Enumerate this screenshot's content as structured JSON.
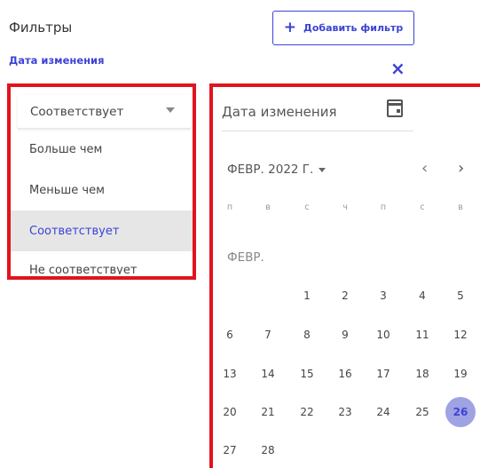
{
  "header": {
    "title": "Фильтры",
    "add_filter_label": "Добавить фильтр",
    "add_icon": "+",
    "active_filter_label": "Дата изменения",
    "close_icon": "×"
  },
  "condition_select": {
    "value": "Соответствует",
    "options": [
      "Больше чем",
      "Меньше чем",
      "Соответствует",
      "Не соответствует"
    ],
    "selected_option": "Соответствует"
  },
  "date_picker": {
    "field_label": "Дата изменения",
    "month_year": "ФЕВР. 2022 Г.",
    "prev_icon": "‹",
    "next_icon": "›",
    "weekdays": [
      "п",
      "в",
      "с",
      "ч",
      "п",
      "с",
      "в"
    ],
    "section_label": "ФЕВР.",
    "selected_day": "26",
    "weeks": [
      [
        "",
        "1",
        "2",
        "3",
        "4",
        "5"
      ],
      [
        "6",
        "7",
        "8",
        "9",
        "10",
        "11",
        "12"
      ],
      [
        "13",
        "14",
        "15",
        "16",
        "17",
        "18",
        "19"
      ],
      [
        "20",
        "21",
        "22",
        "23",
        "24",
        "25",
        "26"
      ],
      [
        "27",
        "28"
      ]
    ]
  },
  "colors": {
    "accent": "#3b43d6",
    "highlight_frame": "#e0141e",
    "selected_day_bg": "#9fa2e3"
  }
}
